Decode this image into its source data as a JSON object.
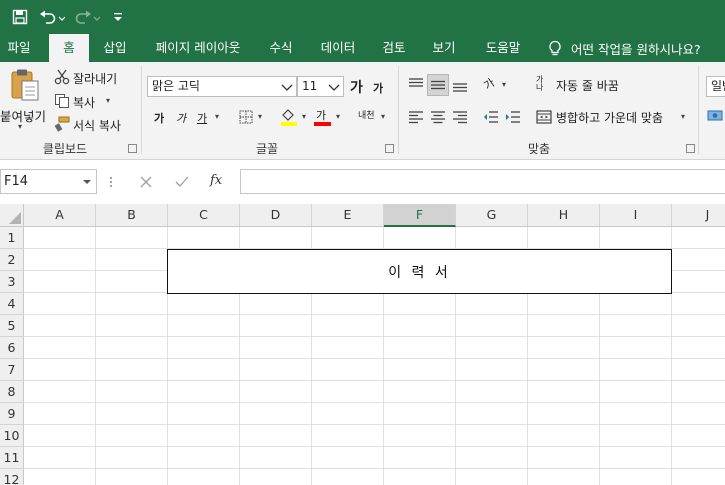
{
  "title_bar": {
    "qat": [
      "save-icon",
      "undo-icon",
      "redo-icon",
      "customize-qat-icon"
    ]
  },
  "tabs": {
    "file": "파일",
    "home": "홈",
    "insert": "삽입",
    "page_layout": "페이지 레이아웃",
    "formulas": "수식",
    "data": "데이터",
    "review": "검토",
    "view": "보기",
    "help": "도움말",
    "tell_me": "어떤 작업을 원하시나요?"
  },
  "clipboard": {
    "paste": "붙여넣기",
    "cut": "잘라내기",
    "copy": "복사",
    "format_painter": "서식 복사",
    "label": "클립보드"
  },
  "font": {
    "name": "맑은 고딕",
    "size": "11",
    "grow": "가",
    "shrink": "가",
    "bold": "가",
    "italic": "가",
    "underline": "가",
    "font_color_glyph": "가",
    "phonetic_glyph": "내천",
    "label": "글꼴",
    "highlight_color": "#ffff00",
    "font_color": "#ff0000"
  },
  "alignment": {
    "wrap_text": "자동 줄 바꿈",
    "merge_center": "병합하고 가운데 맞춤",
    "orient_glyph": "가",
    "wrap_glyph": "가나",
    "label": "맞춤"
  },
  "number": {
    "format_partial": "일반"
  },
  "formula_bar": {
    "name_box": "F14",
    "fx": "fx",
    "value": ""
  },
  "sheet": {
    "columns": [
      "A",
      "B",
      "C",
      "D",
      "E",
      "F",
      "G",
      "H",
      "I",
      "J"
    ],
    "selected_column": "F",
    "rows": [
      "1",
      "2",
      "3",
      "4",
      "5",
      "6",
      "7",
      "8",
      "9",
      "10",
      "11",
      "12"
    ],
    "merged_cell_text": "이 력 서"
  },
  "colors": {
    "brand": "#217346",
    "ribbon_bg": "#f3f3f3"
  }
}
